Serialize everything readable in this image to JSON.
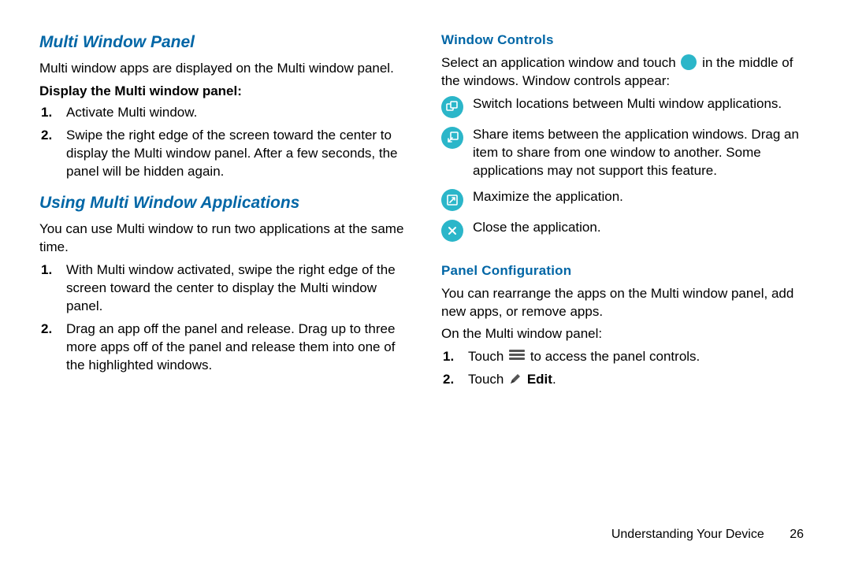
{
  "left": {
    "h1": "Multi Window Panel",
    "p1": "Multi window apps are displayed on the Multi window panel.",
    "sub1": "Display the Multi window panel:",
    "list1": [
      "Activate Multi window.",
      "Swipe the right edge of the screen toward the center to display the Multi window panel. After a few seconds, the panel will be hidden again."
    ],
    "h2": "Using Multi Window Applications",
    "p2": "You can use Multi window to run two applications at the same time.",
    "list2": [
      "With Multi window activated, swipe the right edge of the screen toward the center to display the Multi window panel.",
      "Drag an app off the panel and release. Drag up to three more apps off of the panel and release them into one of the highlighted windows."
    ]
  },
  "right": {
    "h1": "Window Controls",
    "p1a": "Select an application window and touch ",
    "p1b": " in the middle of the windows. Window controls appear:",
    "controls": [
      "Switch locations between Multi window applications.",
      "Share items between the application windows. Drag an item to share from one window to another. Some applications may not support this feature.",
      "Maximize the application.",
      "Close the application."
    ],
    "h2": "Panel Configuration",
    "p2": "You can rearrange the apps on the Multi window panel, add new apps, or remove apps.",
    "p3": "On the Multi window panel:",
    "step1a": "Touch ",
    "step1b": " to access the panel controls.",
    "step2a": "Touch ",
    "step2b": "Edit",
    "step2c": "."
  },
  "footer": {
    "section": "Understanding Your Device",
    "page": "26"
  }
}
